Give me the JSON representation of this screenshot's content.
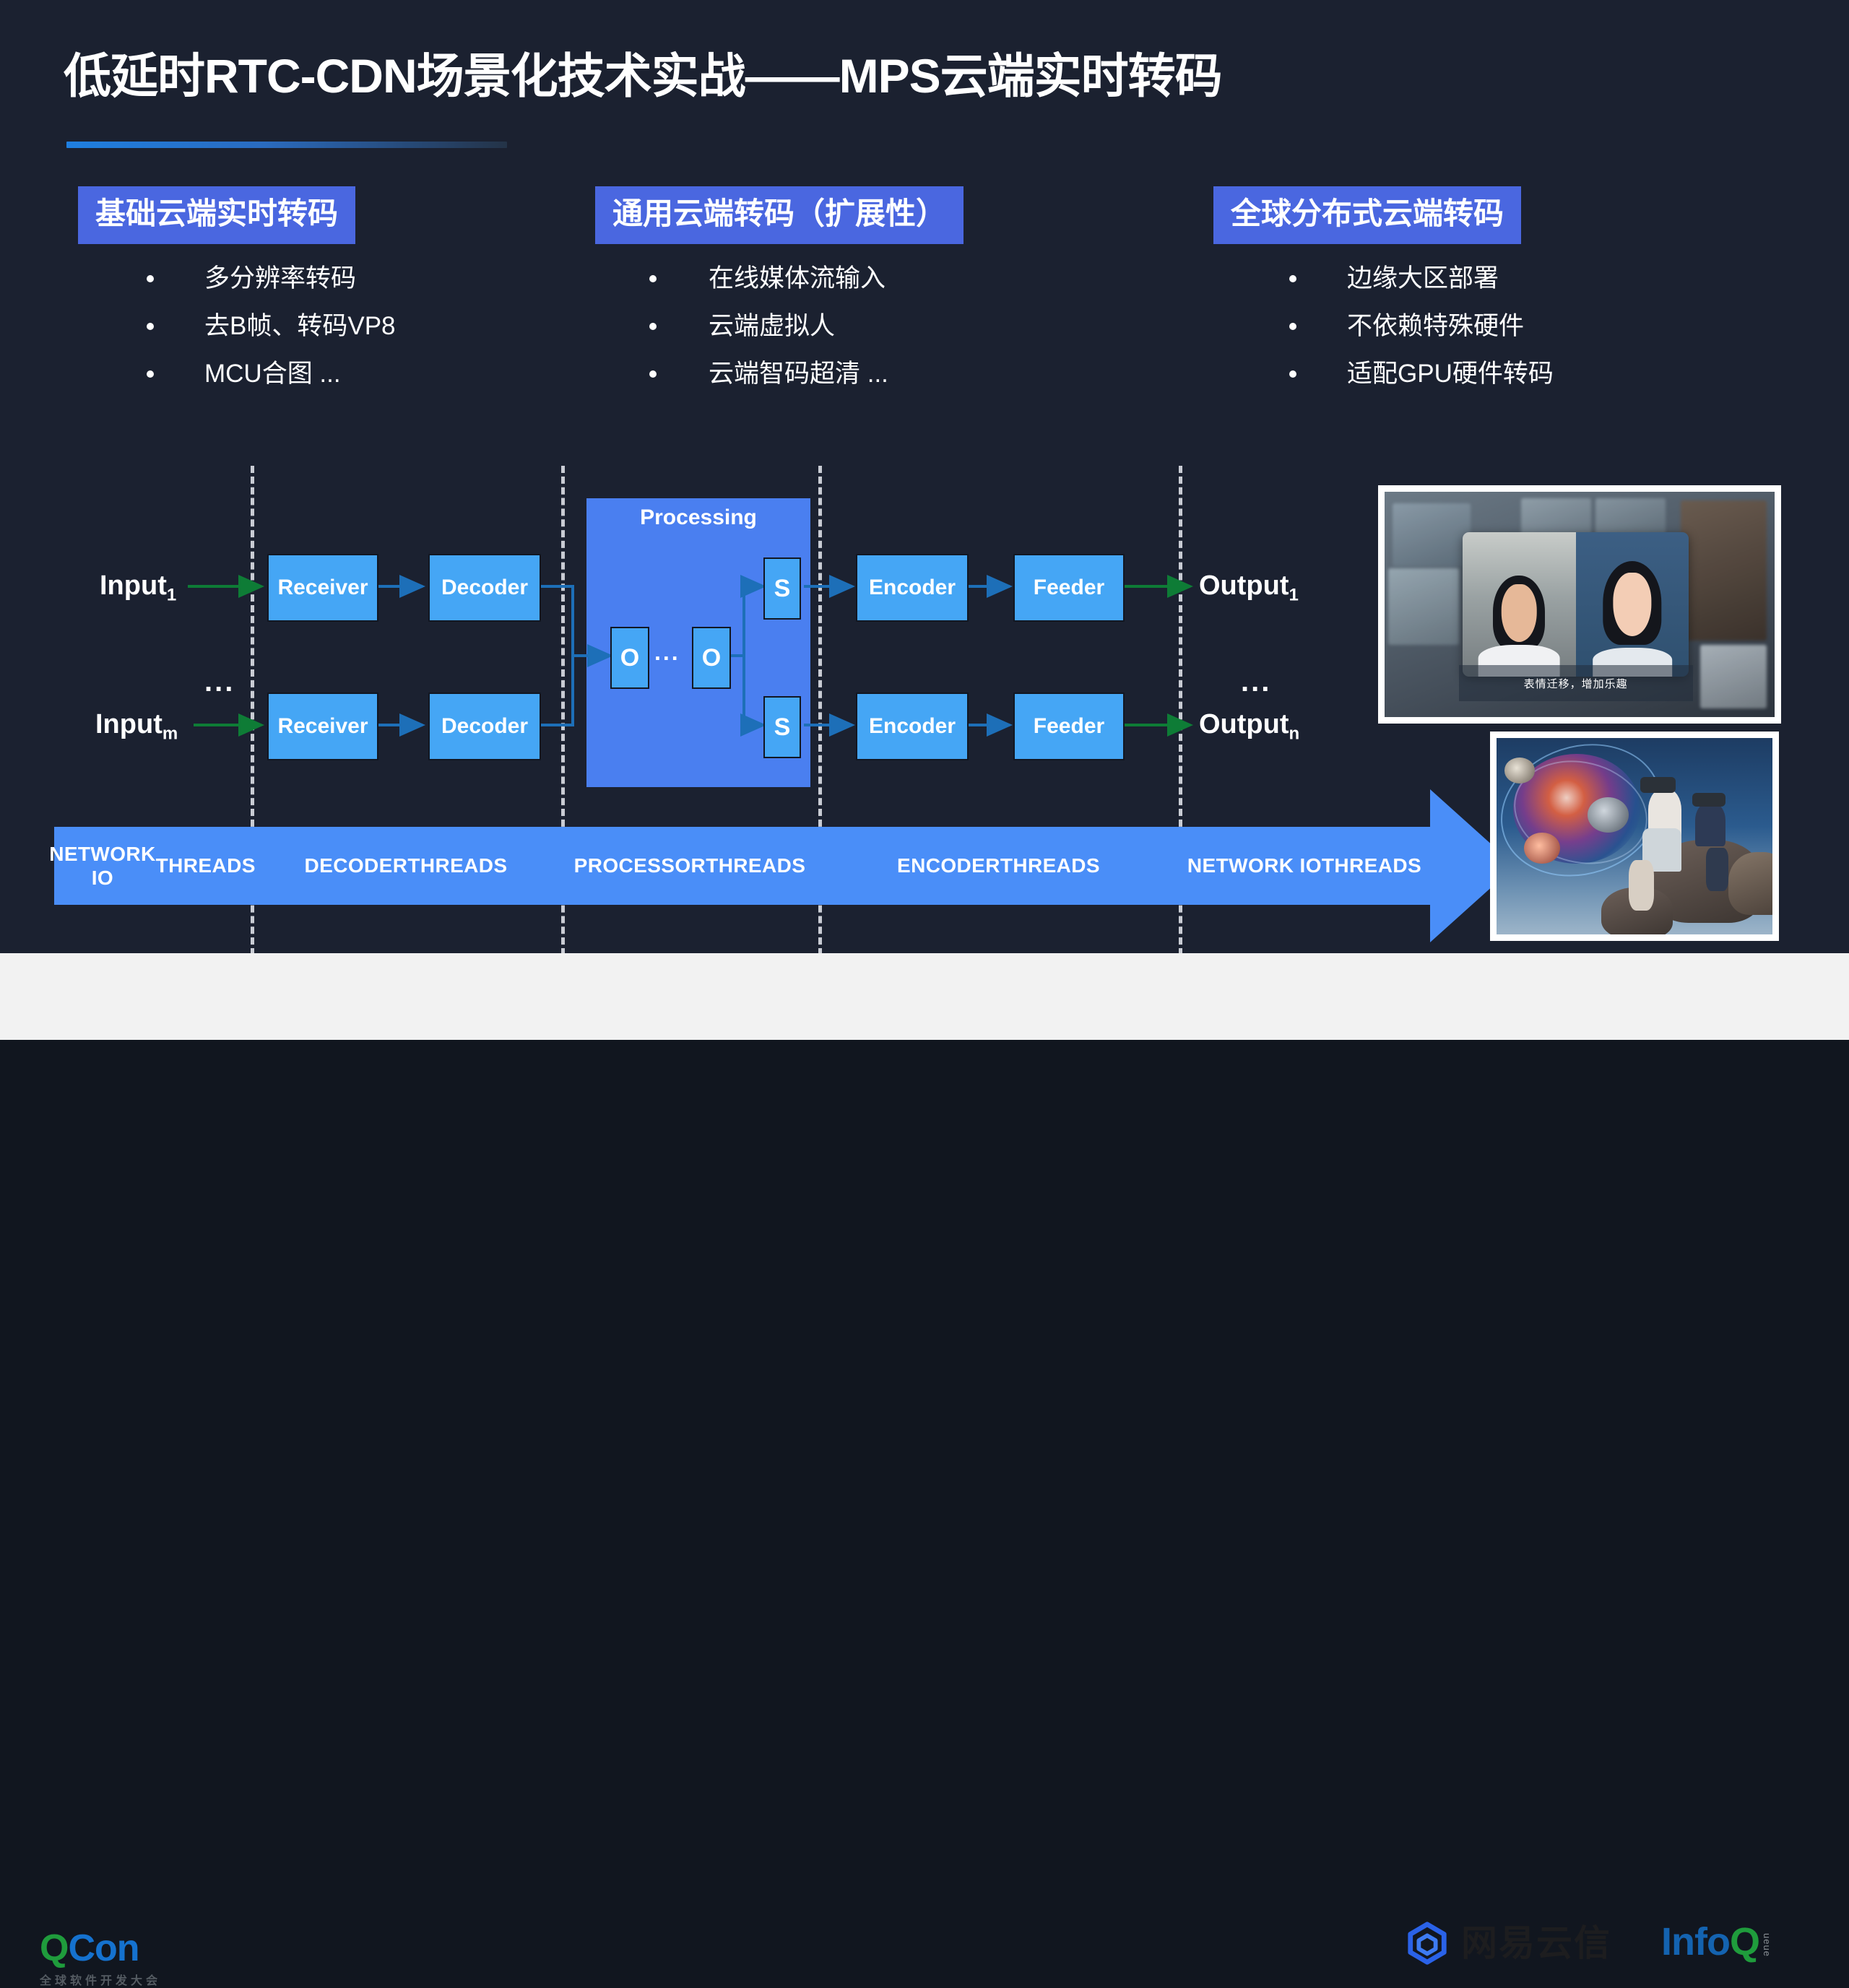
{
  "slide": {
    "title": "低延时RTC-CDN场景化技术实战——MPS云端实时转码",
    "background_color": "#1b2130",
    "accent_color": "#4a67e0",
    "node_color": "#45a6f5",
    "processing_color": "#4a7ff0",
    "banner_color": "#4a8ef8"
  },
  "columns": [
    {
      "heading": "基础云端实时转码",
      "bullets": [
        "多分辨率转码",
        "去B帧、转码VP8",
        "MCU合图 ..."
      ]
    },
    {
      "heading": "通用云端转码（扩展性）",
      "bullets": [
        "在线媒体流输入",
        "云端虚拟人",
        "云端智码超清 ..."
      ]
    },
    {
      "heading": "全球分布式云端转码",
      "bullets": [
        "边缘大区部署",
        "不依赖特殊硬件",
        "适配GPU硬件转码"
      ]
    }
  ],
  "diagram": {
    "inputs": [
      {
        "label": "Input",
        "sub": "1"
      },
      {
        "label": "Input",
        "sub": "m"
      }
    ],
    "input_ellipsis": "...",
    "outputs": [
      {
        "label": "Output",
        "sub": "1"
      },
      {
        "label": "Output",
        "sub": "n"
      }
    ],
    "output_ellipsis": "...",
    "receiver_label": "Receiver",
    "decoder_label": "Decoder",
    "encoder_label": "Encoder",
    "feeder_label": "Feeder",
    "processing_label": "Processing",
    "processor_node_label": "O",
    "processor_ellipsis": "...",
    "splitter_node_label": "S",
    "thread_bands": [
      "NETWORK IO\nTHREADS",
      "DECODER\nTHREADS",
      "PROCESSOR\nTHREADS",
      "ENCODER\nTHREADS",
      "NETWORK IO\nTHREADS"
    ]
  },
  "photos": {
    "meeting": {
      "caption": "表情迁移，增加乐趣",
      "description": "video-conference-avatar-demo"
    },
    "vr": {
      "description": "vr-headset-users-photo"
    }
  },
  "footer": {
    "qcon": {
      "q": "Q",
      "con": "Con",
      "subtitle": "全球软件开发大会"
    },
    "netease": {
      "name": "网易云信"
    },
    "infoq": {
      "info": "Info",
      "q": "Q",
      "ueue": "ueue"
    }
  }
}
